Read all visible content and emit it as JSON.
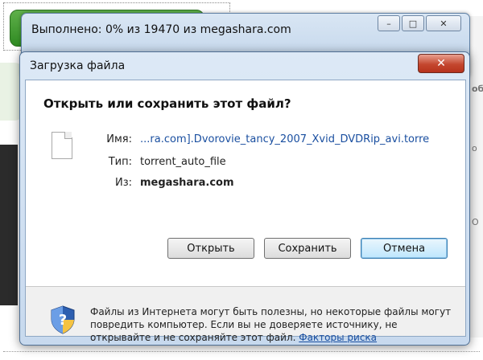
{
  "progress_window": {
    "title": "Выполнено: 0% из 19470 из megashara.com",
    "controls": [
      "–",
      "□",
      "✕"
    ]
  },
  "dialog": {
    "title": "Загрузка файла",
    "close_symbol": "✕",
    "heading": "Открыть или сохранить этот файл?",
    "file": {
      "name_label": "Имя:",
      "name_value": "...ra.com].Dvorovie_tancy_2007_Xvid_DVDRip_avi.torre",
      "type_label": "Тип:",
      "type_value": "torrent_auto_file",
      "from_label": "Из:",
      "from_value": "megashara.com"
    },
    "buttons": {
      "open": "Открыть",
      "save": "Сохранить",
      "cancel": "Отмена"
    },
    "warning": {
      "text": "Файлы из Интернета могут быть полезны, но некоторые файлы могут повредить компьютер. Если вы не доверяете источнику, не открывайте и не сохраняйте этот файл.",
      "link": "Факторы риска"
    }
  },
  "background": {
    "right_fragments": [
      "обо",
      "о",
      "О"
    ]
  },
  "colors": {
    "link": "#1a4fa0",
    "close_button": "#c4472f",
    "title_bar": "#c7d9ee"
  }
}
